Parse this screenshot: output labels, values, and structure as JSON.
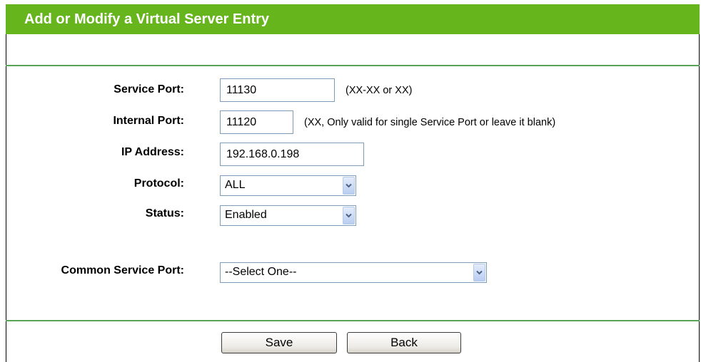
{
  "header": {
    "title": "Add or Modify a Virtual Server Entry"
  },
  "form": {
    "service_port": {
      "label": "Service Port:",
      "value": "11130",
      "hint": "(XX-XX or XX)"
    },
    "internal_port": {
      "label": "Internal Port:",
      "value": "11120",
      "hint": "(XX, Only valid for single Service Port or leave it blank)"
    },
    "ip_address": {
      "label": "IP Address:",
      "value": "192.168.0.198"
    },
    "protocol": {
      "label": "Protocol:",
      "selected": "ALL"
    },
    "status": {
      "label": "Status:",
      "selected": "Enabled"
    },
    "common_service_port": {
      "label": "Common Service Port:",
      "selected": "--Select One--"
    }
  },
  "buttons": {
    "save": "Save",
    "back": "Back"
  },
  "colors": {
    "header_bg": "#66b51c",
    "divider": "#59a356",
    "field_border": "#7f9db9"
  }
}
